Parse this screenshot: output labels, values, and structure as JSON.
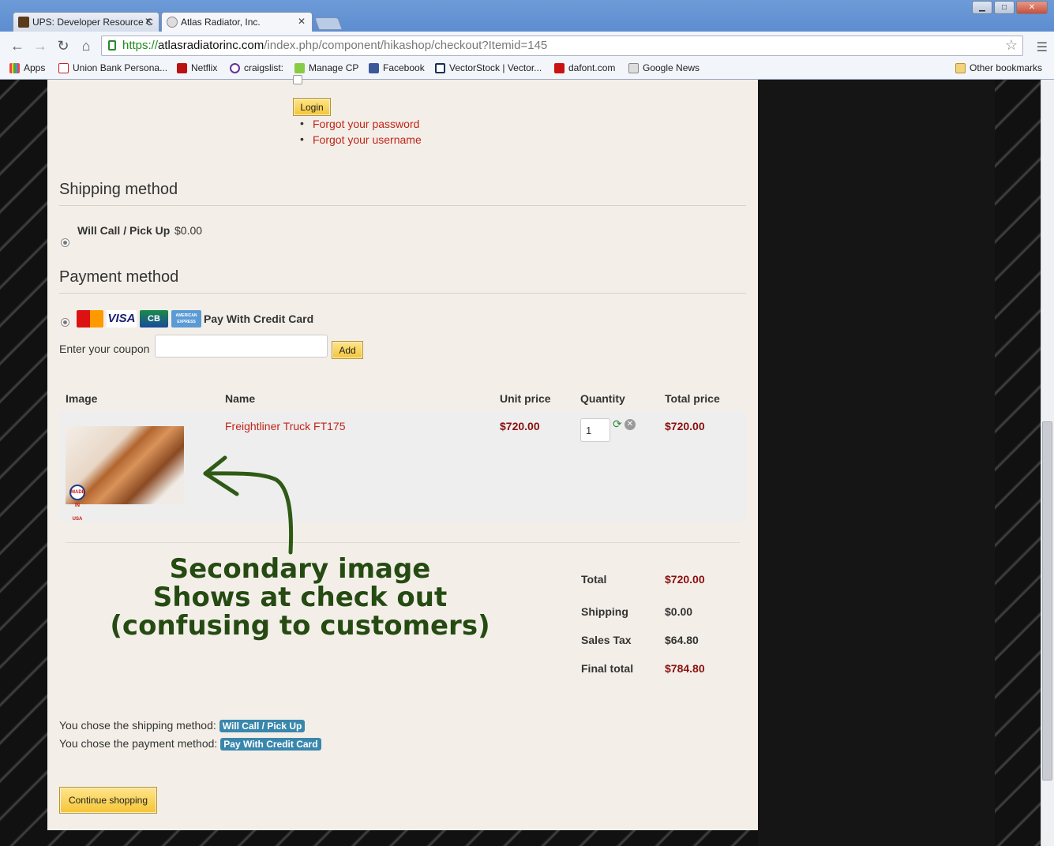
{
  "browser": {
    "tabs": [
      {
        "title": "UPS: Developer Resource C"
      },
      {
        "title": "Atlas Radiator, Inc."
      }
    ],
    "url": {
      "scheme": "https://",
      "host": "atlasradiatorinc.com",
      "path": "/index.php/component/hikashop/checkout?Itemid=145"
    },
    "bookmarks": [
      {
        "label": "Apps"
      },
      {
        "label": "Union Bank Persona..."
      },
      {
        "label": "Netflix"
      },
      {
        "label": "craigslist:"
      },
      {
        "label": "Manage CP"
      },
      {
        "label": "Facebook"
      },
      {
        "label": "VectorStock | Vector..."
      },
      {
        "label": "dafont.com"
      },
      {
        "label": "Google News"
      }
    ],
    "other_bookmarks": "Other bookmarks",
    "window_buttons": {
      "minimize": "▁",
      "maximize": "□",
      "close": "✕"
    }
  },
  "login": {
    "button": "Login",
    "forgot_password": "Forgot your password",
    "forgot_username": "Forgot your username"
  },
  "shipping": {
    "heading": "Shipping method",
    "option_name": "Will Call / Pick Up",
    "option_price": "$0.00"
  },
  "payment": {
    "heading": "Payment method",
    "cards": [
      "MasterCard",
      "VISA",
      "CB",
      "AMERICAN EXPRESS"
    ],
    "option_name": "Pay With Credit Card"
  },
  "coupon": {
    "label": "Enter your coupon",
    "value": "",
    "add_button": "Add"
  },
  "cart": {
    "headers": {
      "image": "Image",
      "name": "Name",
      "unit_price": "Unit price",
      "quantity": "Quantity",
      "total_price": "Total price"
    },
    "items": [
      {
        "name": "Freightliner Truck FT175",
        "unit_price": "$720.00",
        "quantity": "1",
        "total_price": "$720.00",
        "badge": "MADE IN USA"
      }
    ]
  },
  "totals": {
    "total_label": "Total",
    "total_value": "$720.00",
    "shipping_label": "Shipping",
    "shipping_value": "$0.00",
    "tax_label": "Sales Tax",
    "tax_value": "$64.80",
    "final_label": "Final total",
    "final_value": "$784.80"
  },
  "annotation": {
    "line1": "Secondary image",
    "line2": "Shows at check out",
    "line3": "(confusing to customers)",
    "color": "#254a12"
  },
  "summary": {
    "shipping_text": "You chose the shipping method:",
    "shipping_badge": "Will Call / Pick Up",
    "payment_text": "You chose the payment method:",
    "payment_badge": "Pay With Credit Card"
  },
  "continue_button": "Continue shopping",
  "colors": {
    "link": "#c1241b",
    "price": "#8b0f0f",
    "badge": "#3a87ad",
    "button_yellow": "#f5c535"
  }
}
